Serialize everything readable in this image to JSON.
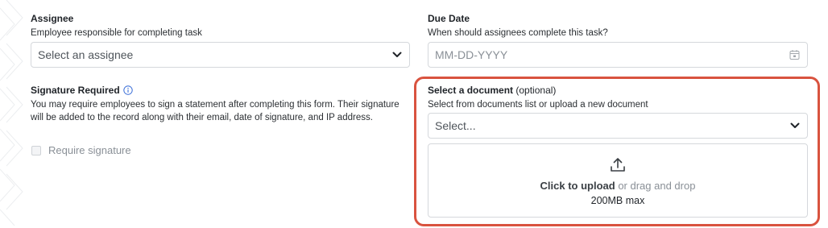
{
  "assignee": {
    "label": "Assignee",
    "description": "Employee responsible for completing task",
    "placeholder": "Select an assignee"
  },
  "due_date": {
    "label": "Due Date",
    "description": "When should assignees complete this task?",
    "placeholder": "MM-DD-YYYY"
  },
  "signature": {
    "label": "Signature Required",
    "description": "You may require employees to sign a statement after completing this form. Their signature will be added to the record along with their email, date of signature, and IP address.",
    "checkbox_label": "Require signature",
    "checked": false
  },
  "document": {
    "label": "Select a document",
    "optional": "(optional)",
    "description": "Select from documents list or upload a new document",
    "placeholder": "Select...",
    "upload_bold": "Click to upload",
    "upload_rest": " or drag and drop",
    "upload_max": "200MB max"
  },
  "colors": {
    "highlight": "#d9533f",
    "info_icon": "#3b6fd8",
    "border": "#d5d8dc"
  },
  "icons": [
    "chevron-down-icon",
    "calendar-icon",
    "info-icon",
    "upload-icon"
  ]
}
